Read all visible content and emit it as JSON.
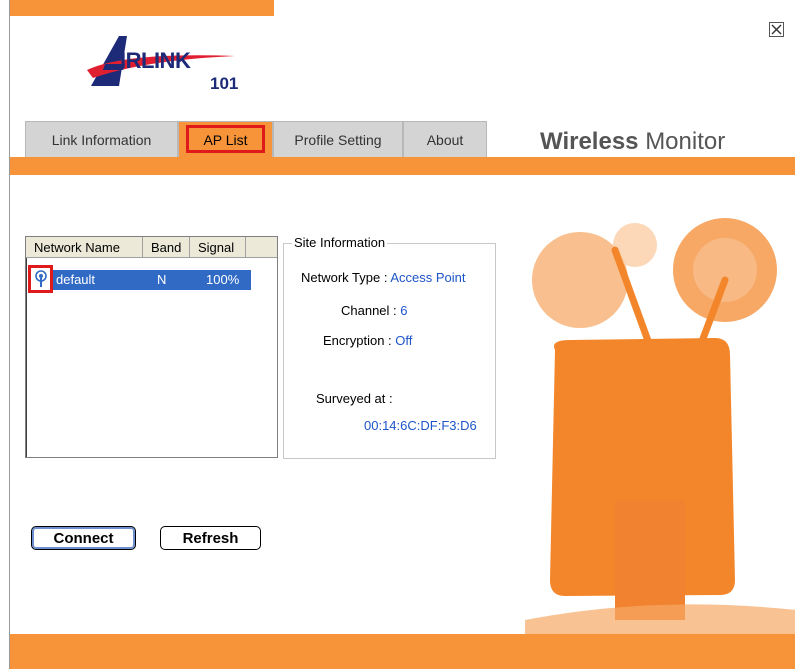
{
  "logo": {
    "text": "IRLINK",
    "number": "101",
    "tm": "™"
  },
  "app": {
    "title_bold": "Wireless",
    "title_light": "Monitor"
  },
  "tabs": [
    {
      "label": "Link Information",
      "active": false
    },
    {
      "label": "AP List",
      "active": true
    },
    {
      "label": "Profile Setting",
      "active": false
    },
    {
      "label": "About",
      "active": false
    }
  ],
  "ap_list": {
    "columns": [
      "Network Name",
      "Band",
      "Signal"
    ],
    "rows": [
      {
        "network_name": "default",
        "band": "N",
        "signal": "100%",
        "selected": true
      }
    ]
  },
  "site_info": {
    "legend": "Site Information",
    "network_type_label": "Network Type :",
    "network_type_value": "Access Point",
    "channel_label": "Channel :",
    "channel_value": "6",
    "encryption_label": "Encryption :",
    "encryption_value": "Off",
    "surveyed_label": "Surveyed at :",
    "surveyed_value": "00:14:6C:DF:F3:D6"
  },
  "buttons": {
    "connect": "Connect",
    "refresh": "Refresh"
  },
  "colors": {
    "accent_orange": "#f7943a",
    "selection_blue": "#316ac5",
    "highlight_red": "#e01a1a",
    "value_blue": "#1e55c8"
  }
}
